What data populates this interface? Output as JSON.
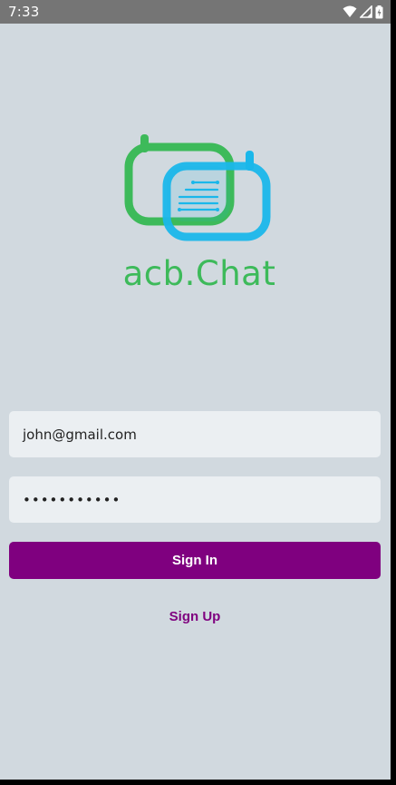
{
  "status_bar": {
    "time": "7:33",
    "icons": [
      "wifi-icon",
      "cellular-signal-icon",
      "battery-charging-icon"
    ]
  },
  "logo": {
    "text": "acb.Chat",
    "colors": {
      "green": "#3dba5a",
      "blue": "#1ab7ea"
    }
  },
  "login_form": {
    "email_value": "john@gmail.com",
    "password_value": "•••••••••••",
    "sign_in_label": "Sign In",
    "sign_up_label": "Sign Up"
  },
  "colors": {
    "background": "#d1d9df",
    "input_background": "#ebeff2",
    "accent": "#7f007f",
    "status_bar": "#757575"
  }
}
